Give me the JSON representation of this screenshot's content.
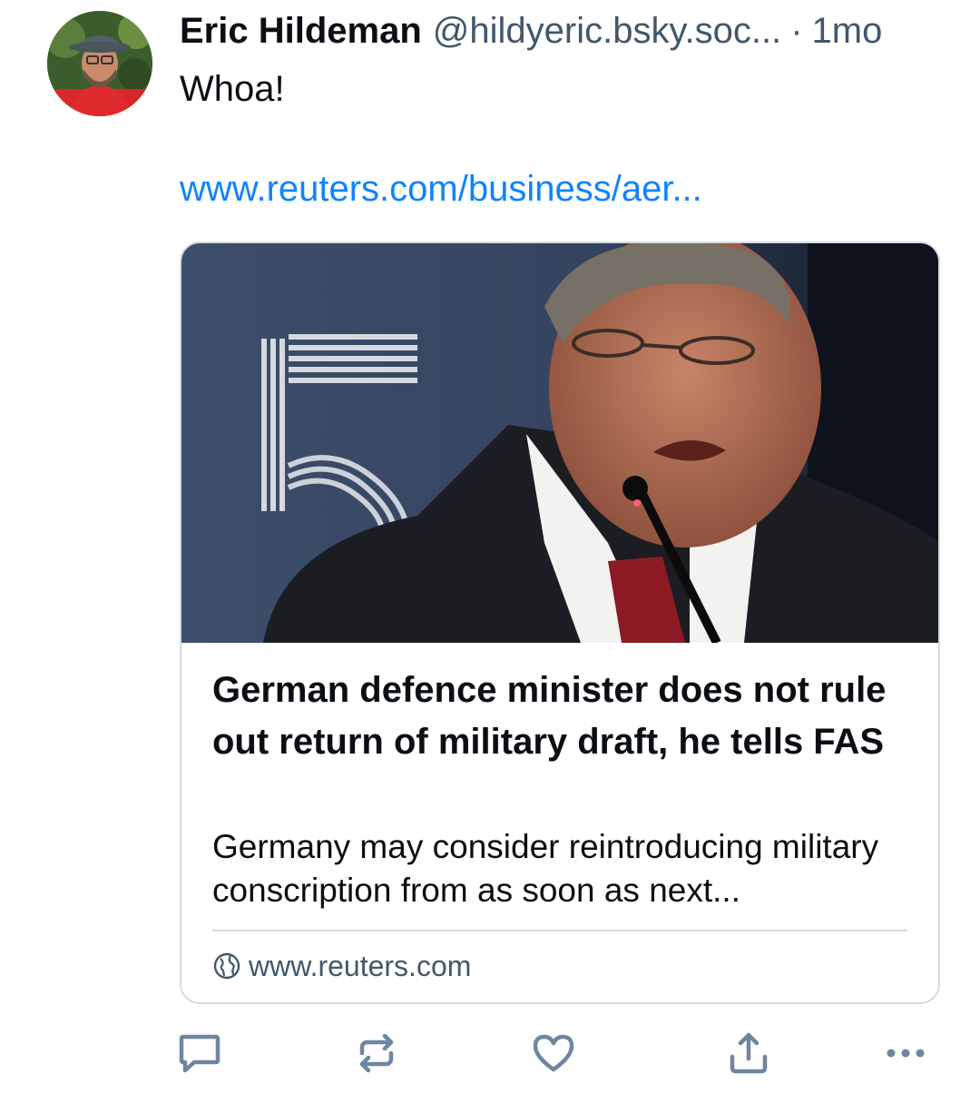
{
  "post": {
    "author_name": "Eric Hildeman",
    "author_handle": "@hildyeric.bsky.soc...",
    "separator": "·",
    "timestamp": "1mo",
    "text": "Whoa!",
    "link_text": "www.reuters.com/business/aer..."
  },
  "embed": {
    "title": "German defence minister does not rule out return of military draft, he tells FAS",
    "description": "Germany may consider reintroducing military conscription from as soon as next...",
    "domain": "www.reuters.com"
  },
  "actions": [
    {
      "name": "reply",
      "icon": "speech-bubble-icon"
    },
    {
      "name": "repost",
      "icon": "repost-arrows-icon"
    },
    {
      "name": "like",
      "icon": "heart-icon"
    },
    {
      "name": "share",
      "icon": "share-upload-icon"
    },
    {
      "name": "more",
      "icon": "ellipsis-icon"
    }
  ],
  "colors": {
    "text": "#0b0f14",
    "secondary": "#42576c",
    "link": "#1083fe",
    "border": "#d4dbe2",
    "icon": "#6f869f"
  }
}
